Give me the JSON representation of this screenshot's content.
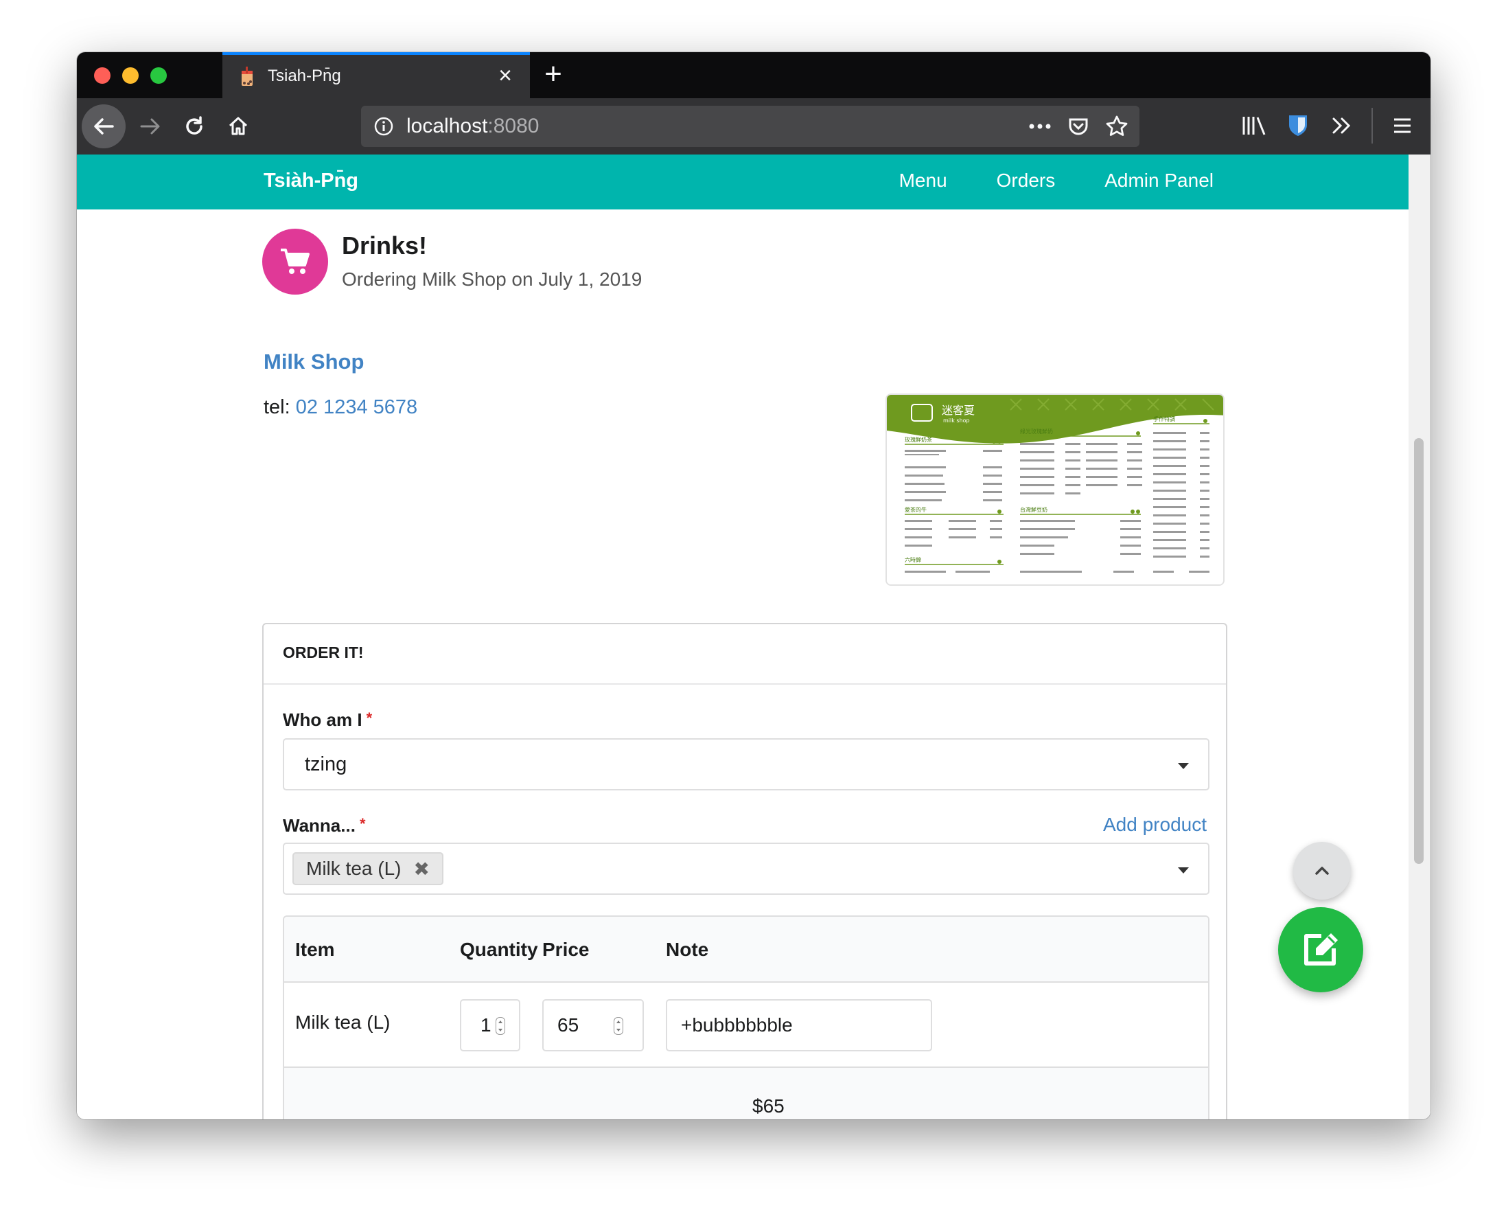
{
  "browser": {
    "tab_title": "Tsiah-Pn̄g",
    "tab_close_icon": "close-icon",
    "new_tab_icon": "plus-icon",
    "url_host": "localhost",
    "url_port": ":8080"
  },
  "nav": {
    "brand": "Tsiàh-Pn̄g",
    "links": [
      "Menu",
      "Orders",
      "Admin Panel"
    ]
  },
  "header": {
    "icon": "cart-icon",
    "icon_color": "#e03997",
    "title": "Drinks!",
    "subtitle": "Ordering Milk Shop on July 1, 2019"
  },
  "shop": {
    "name": "Milk Shop",
    "tel_label": "tel:",
    "tel_number": "02 1234 5678",
    "menu_image": {
      "brand_cn": "迷客夏",
      "brand_en": "milk shop",
      "section_1": "玫瑰鮮奶茶",
      "section_2": "綠光玫瑰鮮奶",
      "section_3": "手作特調",
      "section_4": "愛茶的牛",
      "section_5": "台灣鮮豆奶",
      "section_6": "六時錦"
    }
  },
  "order": {
    "card_title": "ORDER IT!",
    "who_label": "Who am I",
    "who_value": "tzing",
    "wanna_label": "Wanna...",
    "add_product_label": "Add product",
    "selected_products": [
      "Milk tea (L)"
    ],
    "chip_remove_glyph": "✖",
    "table": {
      "headers": [
        "Item",
        "Quantity",
        "Price",
        "Note"
      ],
      "rows": [
        {
          "item": "Milk tea (L)",
          "quantity": "1",
          "price": "65",
          "note": "+bubbbbbble"
        }
      ],
      "total": "$65"
    }
  },
  "colors": {
    "nav_bg": "#00b5ad",
    "link": "#4183c4",
    "required": "#db2828",
    "fab_edit": "#21ba45",
    "fab_up": "#e0e1e2"
  }
}
